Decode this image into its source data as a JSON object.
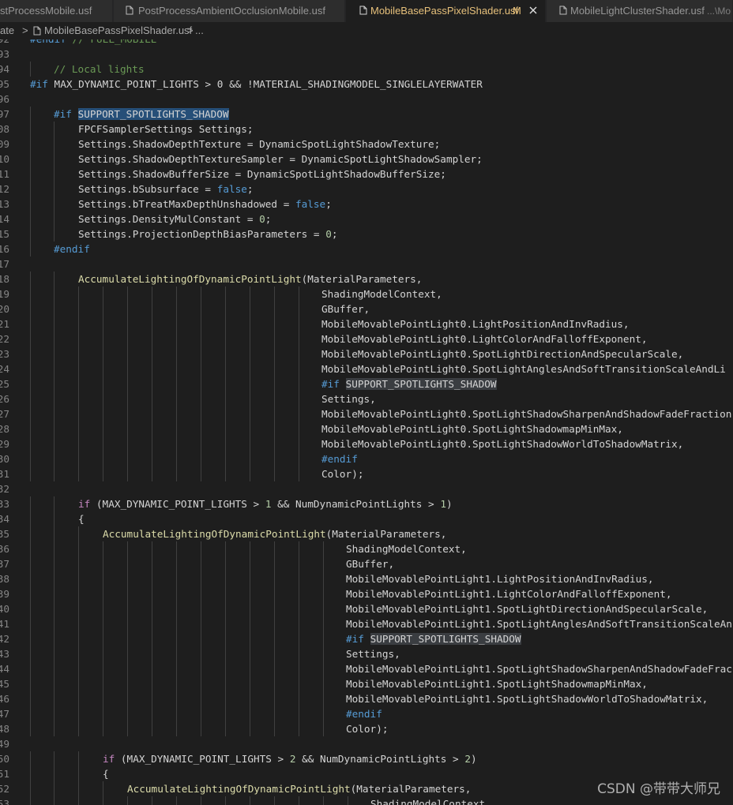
{
  "tabs": [
    {
      "label": "stProcessMobile.usf",
      "active": false
    },
    {
      "label": "PostProcessAmbientOcclusionMobile.usf",
      "active": false
    },
    {
      "label": "MobileBasePassPixelShader.usf",
      "modified": "M",
      "active": true
    },
    {
      "label": "MobileLightClusterShader.usf",
      "path": "...\\Mo",
      "active": false
    }
  ],
  "breadcrumb": {
    "part0": "ate",
    "sep0": ">",
    "part1": "MobileBasePassPixelShader.usf",
    "sep1": ">",
    "part2": "..."
  },
  "editor": {
    "current_line": "07",
    "lines": [
      {
        "n": "92",
        "code": "#endif // FULL_MOBILE"
      },
      {
        "n": "93",
        "code": ""
      },
      {
        "n": "94",
        "code": "// Local lights"
      },
      {
        "n": "95",
        "code": "#if MAX_DYNAMIC_POINT_LIGHTS > 0 && !MATERIAL_SHADINGMODEL_SINGLELAYERWATER"
      },
      {
        "n": "96",
        "code": ""
      },
      {
        "n": "97",
        "code": "#if SUPPORT_SPOTLIGHTS_SHADOW"
      },
      {
        "n": "08",
        "code": "FPCFSamplerSettings Settings;"
      },
      {
        "n": "09",
        "code": "Settings.ShadowDepthTexture = DynamicSpotLightShadowTexture;"
      },
      {
        "n": "10",
        "code": "Settings.ShadowDepthTextureSampler = DynamicSpotLightShadowSampler;"
      },
      {
        "n": "11",
        "code": "Settings.ShadowBufferSize = DynamicSpotLightShadowBufferSize;"
      },
      {
        "n": "12",
        "code": "Settings.bSubsurface = false;"
      },
      {
        "n": "13",
        "code": "Settings.bTreatMaxDepthUnshadowed = false;"
      },
      {
        "n": "14",
        "code": "Settings.DensityMulConstant = 0;"
      },
      {
        "n": "15",
        "code": "Settings.ProjectionDepthBiasParameters = 0;"
      },
      {
        "n": "16",
        "code": "#endif"
      },
      {
        "n": "17",
        "code": ""
      },
      {
        "n": "18",
        "code": "AccumulateLightingOfDynamicPointLight(MaterialParameters,"
      },
      {
        "n": "19",
        "code": "ShadingModelContext,"
      },
      {
        "n": "20",
        "code": "GBuffer,"
      },
      {
        "n": "21",
        "code": "MobileMovablePointLight0.LightPositionAndInvRadius,"
      },
      {
        "n": "22",
        "code": "MobileMovablePointLight0.LightColorAndFalloffExponent,"
      },
      {
        "n": "23",
        "code": "MobileMovablePointLight0.SpotLightDirectionAndSpecularScale,"
      },
      {
        "n": "24",
        "code": "MobileMovablePointLight0.SpotLightAnglesAndSoftTransitionScaleAndLi"
      },
      {
        "n": "25",
        "code": "#if SUPPORT_SPOTLIGHTS_SHADOW"
      },
      {
        "n": "26",
        "code": "Settings,"
      },
      {
        "n": "27",
        "code": "MobileMovablePointLight0.SpotLightShadowSharpenAndShadowFadeFraction"
      },
      {
        "n": "28",
        "code": "MobileMovablePointLight0.SpotLightShadowmapMinMax,"
      },
      {
        "n": "29",
        "code": "MobileMovablePointLight0.SpotLightShadowWorldToShadowMatrix,"
      },
      {
        "n": "30",
        "code": "#endif"
      },
      {
        "n": "31",
        "code": "Color);"
      },
      {
        "n": "32",
        "code": ""
      },
      {
        "n": "33",
        "code": "if (MAX_DYNAMIC_POINT_LIGHTS > 1 && NumDynamicPointLights > 1)"
      },
      {
        "n": "34",
        "code": "{"
      },
      {
        "n": "35",
        "code": "AccumulateLightingOfDynamicPointLight(MaterialParameters,"
      },
      {
        "n": "36",
        "code": "ShadingModelContext,"
      },
      {
        "n": "37",
        "code": "GBuffer,"
      },
      {
        "n": "38",
        "code": "MobileMovablePointLight1.LightPositionAndInvRadius,"
      },
      {
        "n": "39",
        "code": "MobileMovablePointLight1.LightColorAndFalloffExponent,"
      },
      {
        "n": "40",
        "code": "MobileMovablePointLight1.SpotLightDirectionAndSpecularScale,"
      },
      {
        "n": "41",
        "code": "MobileMovablePointLight1.SpotLightAnglesAndSoftTransitionScaleAn"
      },
      {
        "n": "42",
        "code": "#if SUPPORT_SPOTLIGHTS_SHADOW"
      },
      {
        "n": "43",
        "code": "Settings,"
      },
      {
        "n": "44",
        "code": "MobileMovablePointLight1.SpotLightShadowSharpenAndShadowFadeFrac"
      },
      {
        "n": "45",
        "code": "MobileMovablePointLight1.SpotLightShadowmapMinMax,"
      },
      {
        "n": "46",
        "code": "MobileMovablePointLight1.SpotLightShadowWorldToShadowMatrix,"
      },
      {
        "n": "47",
        "code": "#endif"
      },
      {
        "n": "48",
        "code": "Color);"
      },
      {
        "n": "49",
        "code": ""
      },
      {
        "n": "50",
        "code": "if (MAX_DYNAMIC_POINT_LIGHTS > 2 && NumDynamicPointLights > 2)"
      },
      {
        "n": "51",
        "code": "{"
      },
      {
        "n": "52",
        "code": "AccumulateLightingOfDynamicPointLight(MaterialParameters,"
      },
      {
        "n": "53",
        "code": "ShadingModelContext,"
      }
    ]
  },
  "watermark": "CSDN @带带大师兄",
  "colors": {
    "keyword": "#c586c0",
    "preprocessor": "#569cd6",
    "comment": "#6a9955",
    "function": "#dcdcaa",
    "number": "#b5cea8",
    "active_tab_text": "#e6c07b"
  }
}
